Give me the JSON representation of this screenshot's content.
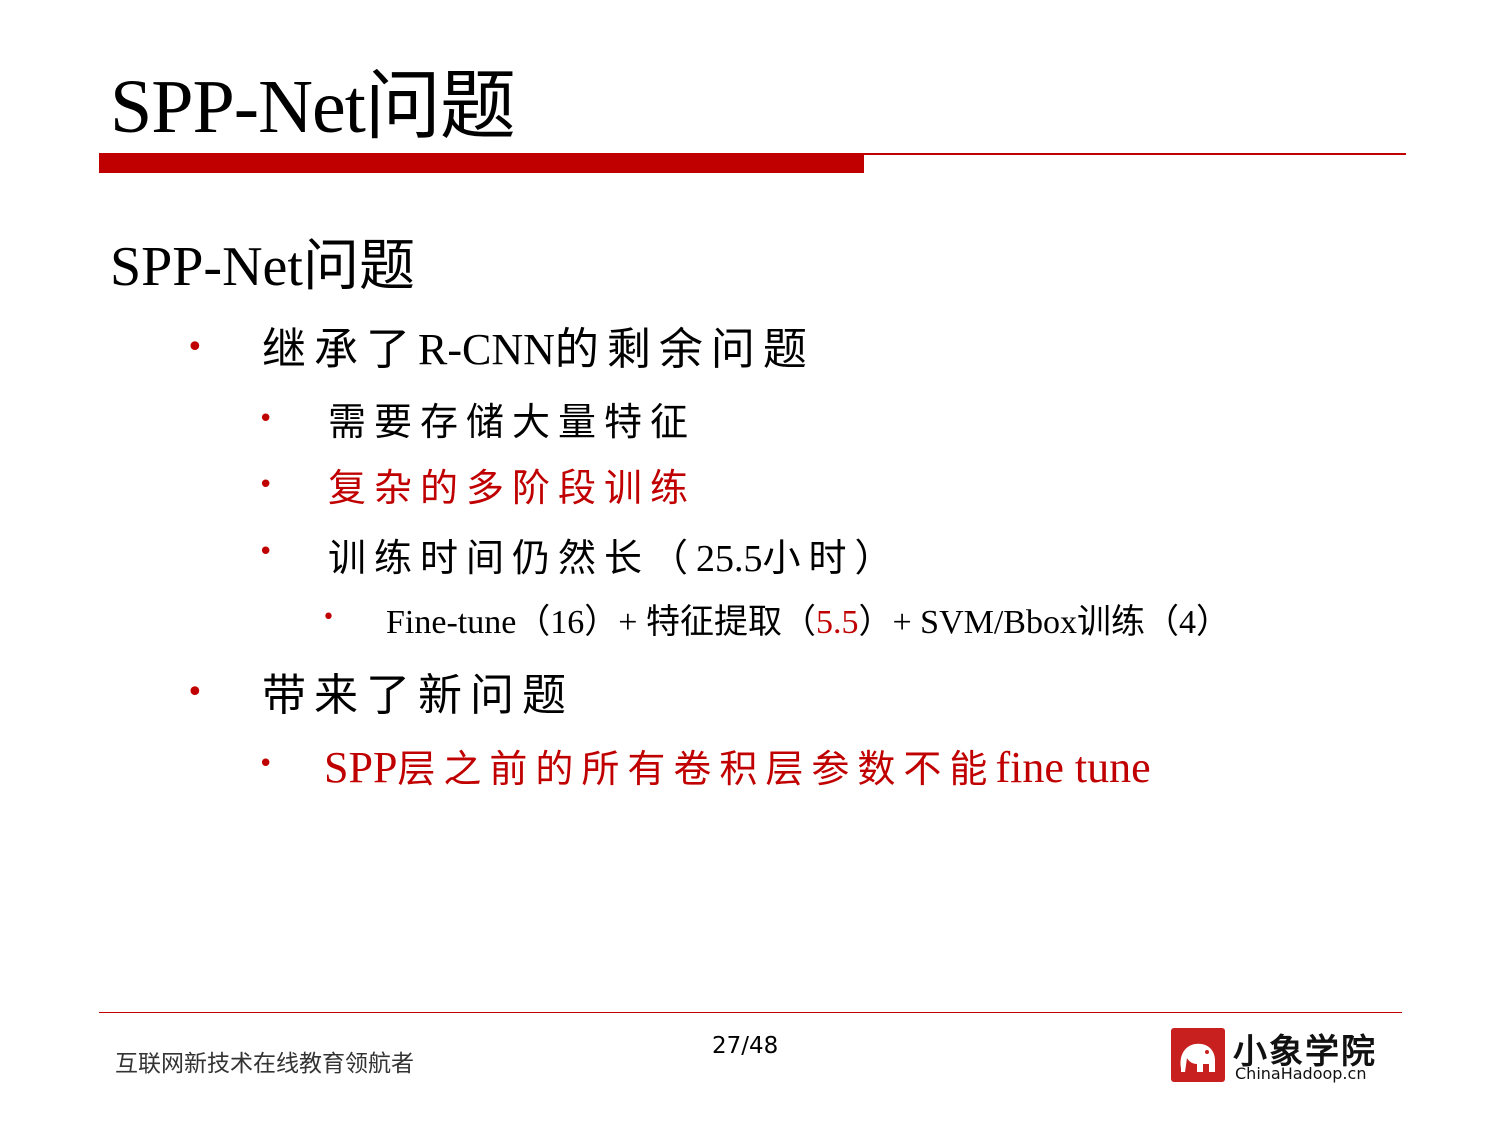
{
  "slide": {
    "title": "SPP-Net问题",
    "heading": "SPP-Net问题",
    "bullet_char": "•",
    "items": [
      {
        "text_prefix": "继承了",
        "text_main": "R-CNN",
        "text_suffix": "的剩余问题"
      },
      {
        "text": "需要存储大量特征"
      },
      {
        "text": "复杂的多阶段训练"
      },
      {
        "text_prefix": "训练时间仍然长（",
        "text_main": "25.5",
        "text_suffix": "小时）"
      },
      {
        "part1": "Fine-tune（16）+ 特征提取（",
        "part2_red": "5.5",
        "part3": "）+ SVM/Bbox训练（4）"
      },
      {
        "text": "带来了新问题"
      },
      {
        "text_prefix": "SPP",
        "text_cjk": "层之前的所有卷积层参数不能",
        "text_suffix": "fine tune"
      }
    ]
  },
  "footer": {
    "slogan": "互联网新技术在线教育领航者",
    "page_number": "27/48",
    "logo_name": "小象学院",
    "logo_site": "ChinaHadoop.cn"
  },
  "colors": {
    "accent": "#c00000",
    "text": "#000000"
  }
}
